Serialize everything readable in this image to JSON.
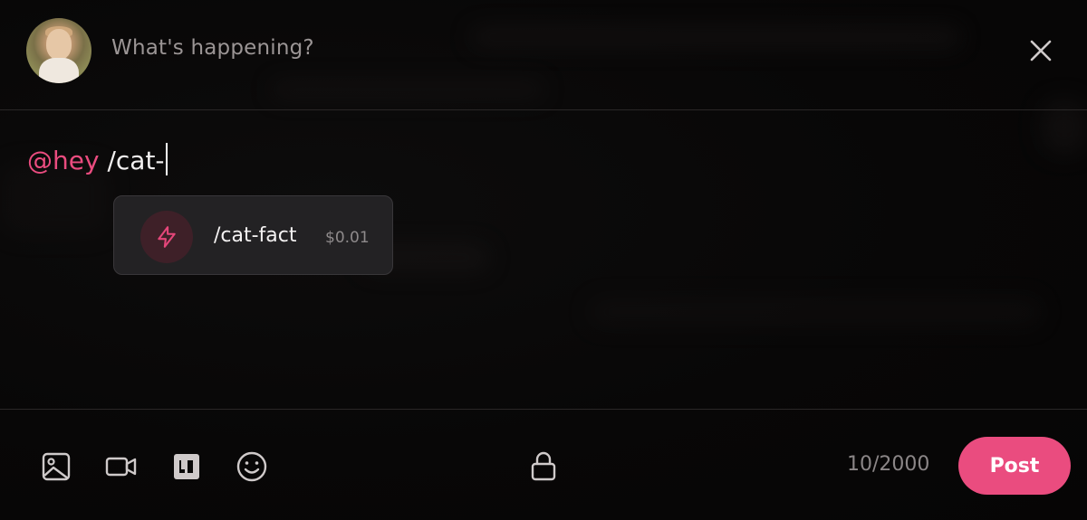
{
  "composer": {
    "placeholder": "What's happening?",
    "mention": "@hey",
    "command_text": "/cat-",
    "char_count": "10/2000",
    "post_label": "Post"
  },
  "suggestion": {
    "command": "/cat-fact",
    "price": "$0.01",
    "icon": "lightning-icon"
  },
  "icons": {
    "close": "close-icon",
    "image": "image-icon",
    "video": "video-icon",
    "gif": "gif-icon",
    "emoji": "emoji-icon",
    "lock": "lock-icon"
  },
  "colors": {
    "accent": "#ea4c7f",
    "background": "#080707",
    "muted_text": "#9b9595"
  }
}
